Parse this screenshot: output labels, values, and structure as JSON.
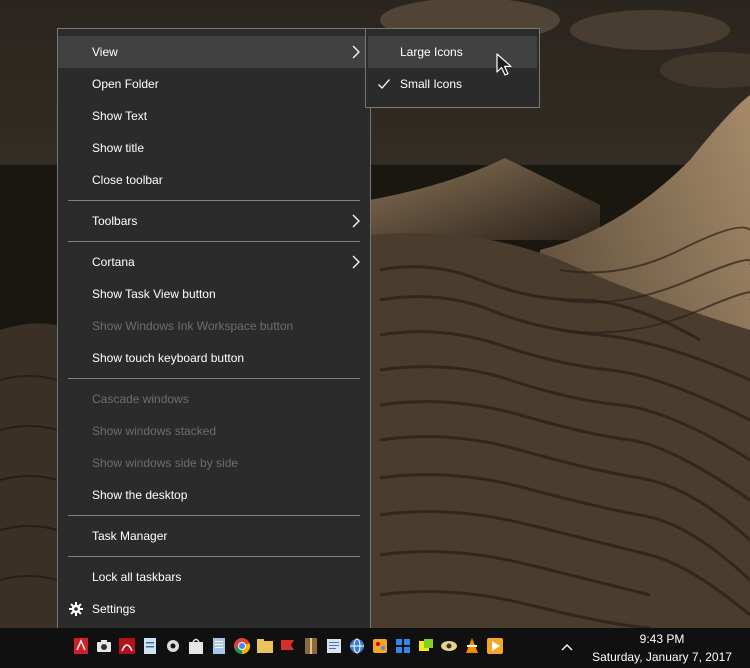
{
  "context_menu": {
    "view": "View",
    "open_folder": "Open Folder",
    "show_text": "Show Text",
    "show_title": "Show title",
    "close_toolbar": "Close toolbar",
    "toolbars": "Toolbars",
    "cortana": "Cortana",
    "show_task_view": "Show Task View button",
    "show_ink_workspace": "Show Windows Ink Workspace button",
    "show_touch_keyboard": "Show touch keyboard button",
    "cascade_windows": "Cascade windows",
    "show_windows_stacked": "Show windows stacked",
    "show_windows_side_by_side": "Show windows side by side",
    "show_desktop": "Show the desktop",
    "task_manager": "Task Manager",
    "lock_taskbars": "Lock all taskbars",
    "settings": "Settings"
  },
  "submenu": {
    "large_icons": "Large Icons",
    "small_icons": "Small Icons",
    "checked": "small_icons"
  },
  "taskbar": {
    "icons": [
      "pdf-icon",
      "camera-icon",
      "acrobat-icon",
      "document-icon",
      "gear-icon",
      "store-icon",
      "notepad-icon",
      "chrome-icon",
      "folder-icon",
      "flag-icon",
      "archive-icon",
      "notes-icon",
      "globe-icon",
      "paint-icon",
      "grid-icon",
      "stickers-icon",
      "eye-icon",
      "vlc-icon",
      "media-player-icon"
    ]
  },
  "clock": {
    "time": "9:43 PM",
    "date": "Saturday, January 7, 2017"
  },
  "colors": {
    "menu_bg": "#2b2b2b",
    "menu_hover": "#414141",
    "disabled_text": "#6d6d6d",
    "taskbar_bg": "#101010"
  }
}
